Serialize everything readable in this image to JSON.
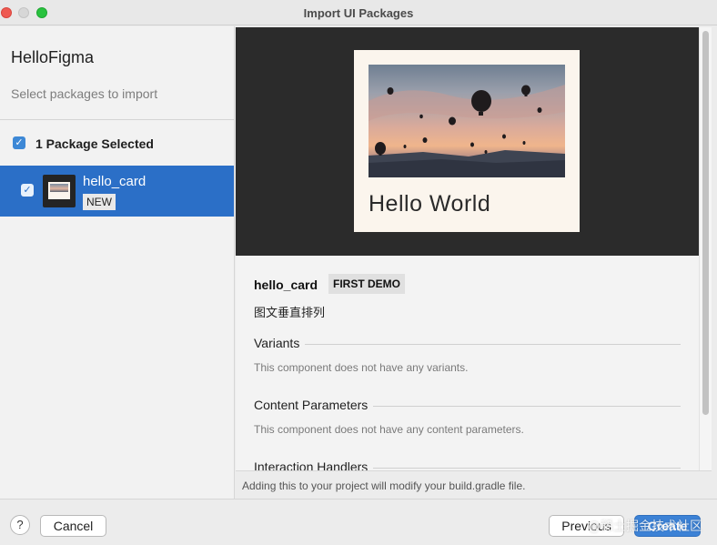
{
  "window": {
    "title": "Import UI Packages"
  },
  "sidebar": {
    "app_name": "HelloFigma",
    "subtitle": "Select packages to import",
    "package_count_label": "1 Package Selected",
    "packages": [
      {
        "name": "hello_card",
        "badge": "NEW",
        "checked": true
      }
    ]
  },
  "preview": {
    "card_title": "Hello World",
    "image_description_icon": "hot-air-balloons-image"
  },
  "details": {
    "component_name": "hello_card",
    "badge": "FIRST DEMO",
    "description": "图文垂直排列",
    "sections": [
      {
        "title": "Variants",
        "text": "This component does not have any variants."
      },
      {
        "title": "Content Parameters",
        "text": "This component does not have any content parameters."
      },
      {
        "title": "Interaction Handlers",
        "text": ""
      }
    ]
  },
  "footer_note": "Adding this to your project will modify your build.gradle file.",
  "buttons": {
    "help": "?",
    "cancel": "Cancel",
    "previous": "Previous",
    "create": "Create"
  },
  "watermark": "@稀土掘金技术社区",
  "colors": {
    "accent": "#2b6fc7",
    "preview_bg": "#2b2b2b",
    "card_bg": "#fbf5ed"
  }
}
